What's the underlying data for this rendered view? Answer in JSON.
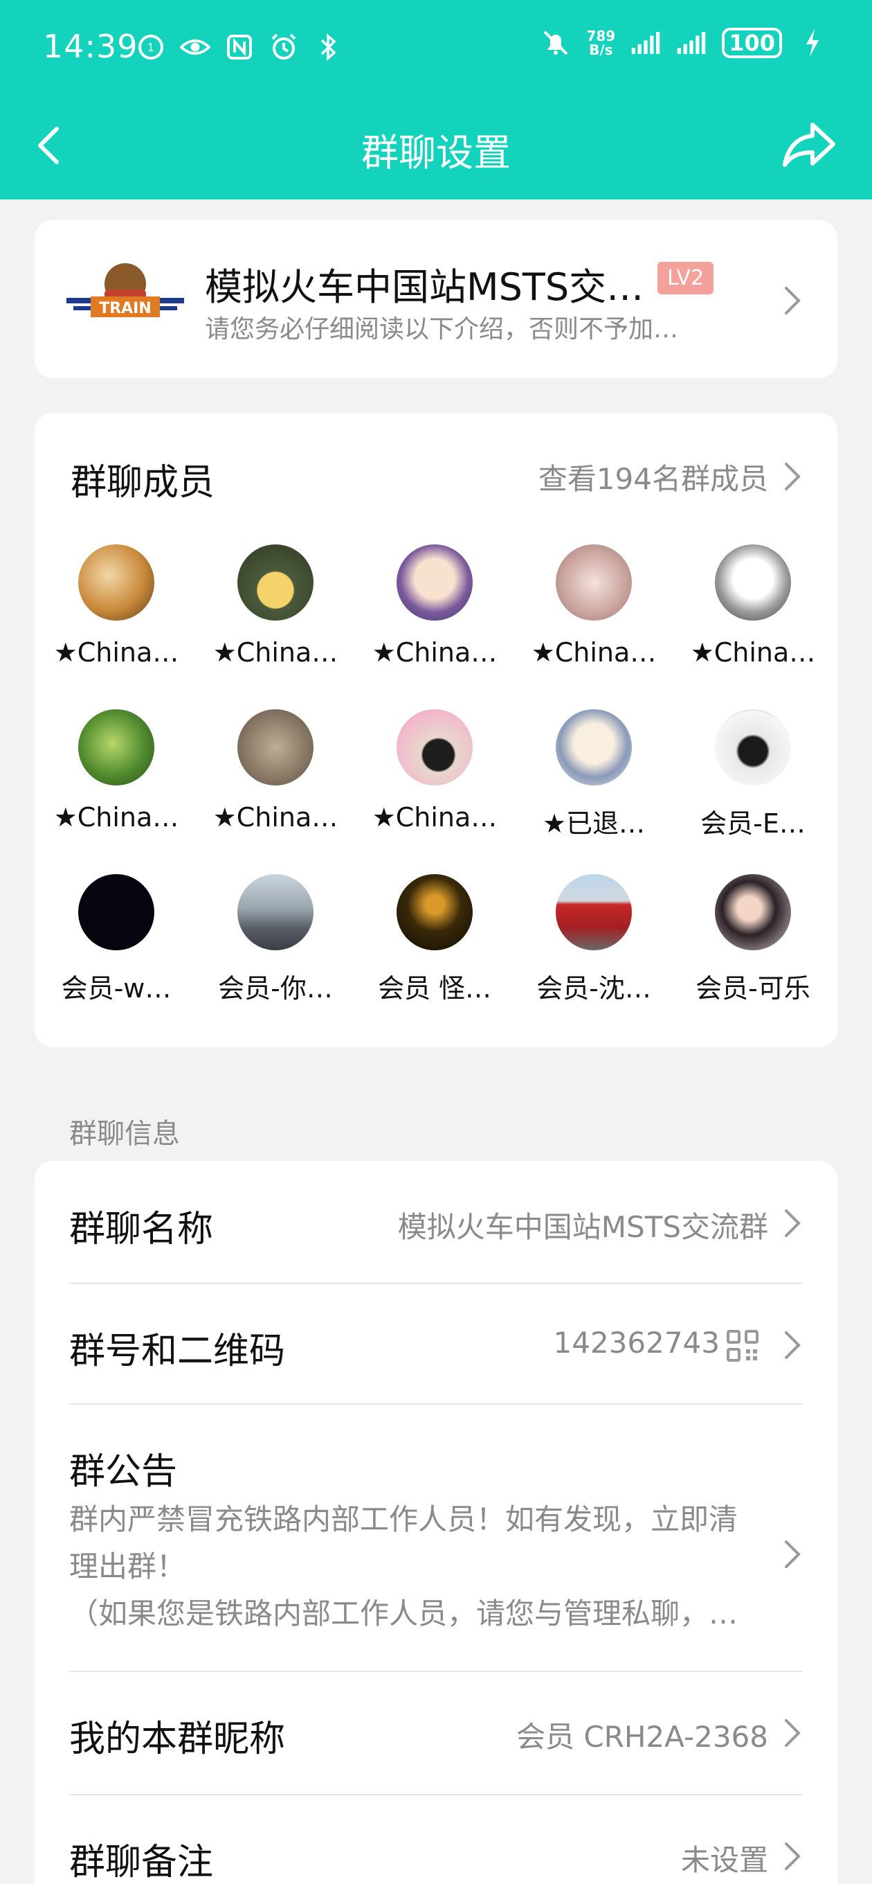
{
  "status_bar": {
    "time": "14:39",
    "net_speed_value": "789",
    "net_speed_unit": "B/s",
    "battery": "100",
    "colors": {
      "bg": "#14d3bd"
    }
  },
  "nav": {
    "title": "群聊设置",
    "back_icon": "chevron-left-icon",
    "share_icon": "share-icon"
  },
  "group": {
    "name": "模拟火车中国站MSTS交…",
    "level": "LV2",
    "intro": "请您务必仔细阅读以下介绍，否则不予加…"
  },
  "members": {
    "title": "群聊成员",
    "view_all": "查看194名群成员",
    "list": [
      {
        "name": "★China…"
      },
      {
        "name": "★China…"
      },
      {
        "name": "★China…"
      },
      {
        "name": "★China…"
      },
      {
        "name": "★China…"
      },
      {
        "name": "★China…"
      },
      {
        "name": "★China…"
      },
      {
        "name": "★China…"
      },
      {
        "name": "★已退…"
      },
      {
        "name": "会员-E…"
      },
      {
        "name": "会员-w…"
      },
      {
        "name": "会员-你…"
      },
      {
        "name": "会员  怪…"
      },
      {
        "name": "会员-沈…"
      },
      {
        "name": "会员-可乐"
      }
    ]
  },
  "info": {
    "section_label": "群聊信息",
    "group_name_label": "群聊名称",
    "group_name_value": "模拟火车中国站MSTS交流群",
    "group_number_label": "群号和二维码",
    "group_number_value": "142362743",
    "notice_label": "群公告",
    "notice_line1": "群内严禁冒充铁路内部工作人员！如有发现，立即清",
    "notice_line2": "理出群！",
    "notice_line3": "（如果您是铁路内部工作人员，请您与管理私聊，…",
    "nickname_label": "我的本群昵称",
    "nickname_value": "会员  CRH2A-2368",
    "remark_label": "群聊备注",
    "remark_value": "未设置"
  }
}
